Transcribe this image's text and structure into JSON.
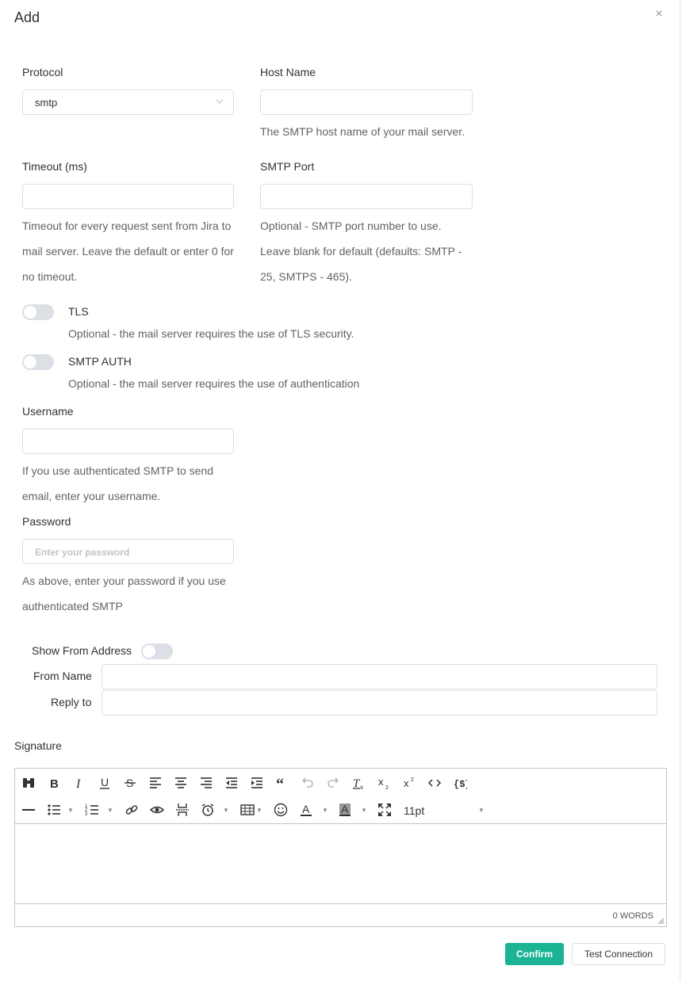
{
  "dialog": {
    "title": "Add",
    "close_icon": "×"
  },
  "protocol": {
    "label": "Protocol",
    "value": "smtp"
  },
  "host": {
    "label": "Host Name",
    "value": "",
    "help": "The SMTP host name of your mail server."
  },
  "timeout": {
    "label": "Timeout (ms)",
    "value": "",
    "help": [
      "Timeout for every request sent from Jira to",
      "mail server. Leave the default or enter 0 for",
      "no timeout."
    ]
  },
  "port": {
    "label": "SMTP Port",
    "value": "",
    "help": [
      "Optional - SMTP port number to use.",
      "Leave blank for default (defaults: SMTP -",
      "25, SMTPS - 465)."
    ]
  },
  "tls": {
    "label": "TLS",
    "help": "Optional - the mail server requires the use of TLS security."
  },
  "auth": {
    "label": "SMTP AUTH",
    "help": "Optional - the mail server requires the use of authentication"
  },
  "username": {
    "label": "Username",
    "value": "",
    "help": [
      "If you use authenticated SMTP to send",
      "email, enter your username."
    ]
  },
  "password": {
    "label": "Password",
    "placeholder": "Enter your password",
    "help": [
      "As above, enter your password if you use",
      "authenticated SMTP"
    ]
  },
  "show_from": {
    "label": "Show From Address"
  },
  "from_name": {
    "label": "From Name",
    "value": ""
  },
  "reply_to": {
    "label": "Reply to",
    "value": ""
  },
  "signature": {
    "label": "Signature",
    "font_size": "11pt",
    "word_count": "0 WORDS"
  },
  "buttons": {
    "confirm": "Confirm",
    "test": "Test Connection"
  },
  "colors": {
    "primary": "#1ab394",
    "border": "#dcdfe6",
    "switch_off": "#dcdfe6"
  }
}
